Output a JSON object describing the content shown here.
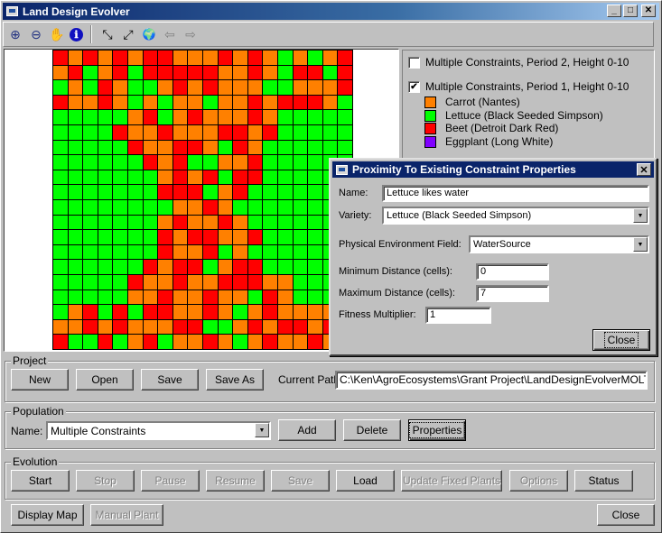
{
  "window": {
    "title": "Land Design Evolver",
    "controls": {
      "minimize": "_",
      "maximize": "□",
      "close": "✕"
    }
  },
  "toolbar": {
    "tools": [
      {
        "name": "zoom-in-icon",
        "glyph": "⊕"
      },
      {
        "name": "zoom-out-icon",
        "glyph": "⊖"
      },
      {
        "name": "pan-hand-icon",
        "glyph": "✋"
      },
      {
        "name": "info-icon",
        "glyph": "ℹ"
      },
      {
        "name": "zoom-extent-in-icon",
        "glyph": "⤡"
      },
      {
        "name": "zoom-extent-out-icon",
        "glyph": "⤢"
      },
      {
        "name": "globe-icon",
        "glyph": "🌍"
      },
      {
        "name": "back-arrow-icon",
        "glyph": "⇦"
      },
      {
        "name": "forward-arrow-icon",
        "glyph": "⇨"
      }
    ]
  },
  "map": {
    "colors": {
      "O": "#ff8000",
      "G": "#00ff00",
      "R": "#ff0000",
      "P": "#8000ff"
    },
    "rows": [
      "RORORORROOOROROGOGOR",
      "ORGORGRRRRROOROGRRGRO",
      "GOGROGGOROROOOGGOOOR",
      "ROOROGOGOOGOORORRROG",
      "GGGGGORGOROOOROGGGGG",
      "GGGGROOROOORRORGGGGG",
      "GGGGGROORROGROGGGGGG",
      "GGGGGGRORGGOORGGGGGG",
      "GGGGGGGORORGRRGGGGGG",
      "GGGGGGGRRRGORGGGGGGG",
      "GGGGGGGGOOROGGGGGGGG",
      "GGGGGGGOROOROGGGGGGG",
      "GGGGGGGRORROORGGGGGG",
      "GGGGGGGROORGOGGGGGGG",
      "GGGGGGRORRGORRGGGGGG",
      "GGGGGROOROORRROOGGGGG",
      "GGGGGOOROOROOGROGGGG",
      "GORGRGRROOROGOROOOOR",
      "OOROROOORRGGORORRORO",
      "RGGRGORGOOROGOROOROO"
    ]
  },
  "legend": {
    "layers": [
      {
        "label": "Multiple Constraints, Period 2, Height 0-10",
        "checked": false
      },
      {
        "label": "Multiple Constraints, Period 1, Height 0-10",
        "checked": true
      }
    ],
    "items": [
      {
        "label": "Carrot (Nantes)",
        "color": "#ff8000"
      },
      {
        "label": "Lettuce (Black Seeded Simpson)",
        "color": "#00ff00"
      },
      {
        "label": "Beet (Detroit Dark Red)",
        "color": "#ff0000"
      },
      {
        "label": "Eggplant (Long White)",
        "color": "#8000ff"
      }
    ]
  },
  "dialog": {
    "title": "Proximity To Existing Constraint Properties",
    "name_label": "Name:",
    "name_value": "Lettuce likes water",
    "variety_label": "Variety:",
    "variety_value": "Lettuce (Black Seeded Simpson)",
    "env_label": "Physical Environment Field:",
    "env_value": "WaterSource",
    "min_label": "Minimum Distance (cells):",
    "min_value": "0",
    "max_label": "Maximum Distance (cells):",
    "max_value": "7",
    "fitness_label": "Fitness Multiplier:",
    "fitness_value": "1",
    "close_label": "Close"
  },
  "project": {
    "group_label": "Project",
    "new_label": "New",
    "open_label": "Open",
    "save_label": "Save",
    "saveas_label": "Save As",
    "path_label": "Current Path:",
    "path_value": "C:\\Ken\\AgroEcosystems\\Grant Project\\LandDesignEvolverMOLT\\Proj"
  },
  "population": {
    "group_label": "Population",
    "name_label": "Name:",
    "name_value": "Multiple Constraints",
    "add_label": "Add",
    "delete_label": "Delete",
    "properties_label": "Properties"
  },
  "evolution": {
    "group_label": "Evolution",
    "buttons": [
      {
        "label": "Start",
        "enabled": true
      },
      {
        "label": "Stop",
        "enabled": false
      },
      {
        "label": "Pause",
        "enabled": false
      },
      {
        "label": "Resume",
        "enabled": false
      },
      {
        "label": "Save",
        "enabled": false
      },
      {
        "label": "Load",
        "enabled": true
      },
      {
        "label": "Update Fixed Plants",
        "enabled": false
      },
      {
        "label": "Options",
        "enabled": false
      },
      {
        "label": "Status",
        "enabled": true
      }
    ]
  },
  "footer": {
    "display_map_label": "Display Map",
    "manual_plant_label": "Manual Plant",
    "close_label": "Close"
  }
}
